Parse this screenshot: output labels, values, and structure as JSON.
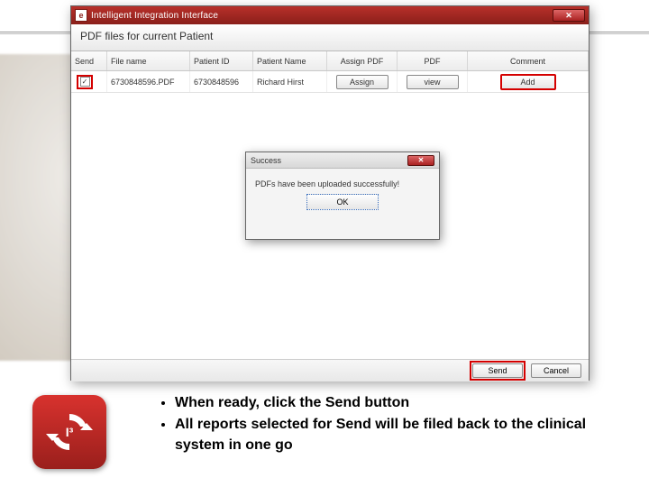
{
  "window": {
    "icon_letter": "e",
    "title": "Intelligent Integration Interface",
    "close_glyph": "✕",
    "header": "PDF files for current Patient",
    "columns": {
      "send": "Send",
      "file": "File name",
      "pid": "Patient ID",
      "pname": "Patient Name",
      "assign": "Assign PDF",
      "pdf": "PDF",
      "comment": "Comment"
    },
    "row": {
      "checked": "✓",
      "file": "6730848596.PDF",
      "pid": "6730848596",
      "pname": "Richard Hirst",
      "assign_btn": "Assign",
      "view_btn": "view",
      "add_btn": "Add"
    },
    "footer": {
      "send": "Send",
      "cancel": "Cancel"
    }
  },
  "modal": {
    "title": "Success",
    "close_glyph": "✕",
    "message": "PDFs have been uploaded successfully!",
    "ok": "OK"
  },
  "bullets": {
    "b1": "When ready, click the Send button",
    "b2": "All reports selected for Send will be filed back to the clinical system in one go"
  },
  "logo": {
    "label": "I³"
  }
}
